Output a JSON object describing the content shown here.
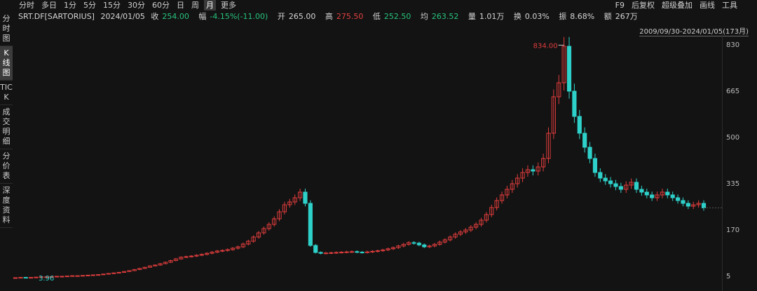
{
  "toolbar": {
    "periods": [
      "分时",
      "多日",
      "1分",
      "5分",
      "15分",
      "30分",
      "60分",
      "日",
      "周",
      "月",
      "更多"
    ],
    "active": "月",
    "right": [
      "F9",
      "后复权",
      "超级叠加",
      "画线",
      "工具"
    ]
  },
  "left_tabs": [
    {
      "label": "分时图",
      "active": false
    },
    {
      "label": "K线图",
      "active": true
    },
    {
      "label": "TICK",
      "active": false
    },
    {
      "label": "成交明细",
      "active": false
    },
    {
      "label": "分价表",
      "active": false
    },
    {
      "label": "深度资料",
      "active": false
    }
  ],
  "info": {
    "ticker": "SRT.DF[SARTORIUS]",
    "date": "2024/01/05",
    "close_label": "收",
    "close": "254.00",
    "chg_label": "幅",
    "chg": "-4.15%(-11.00)",
    "open_label": "开",
    "open": "265.00",
    "high_label": "高",
    "high": "275.50",
    "low_label": "低",
    "low": "252.50",
    "avg_label": "均",
    "avg": "263.52",
    "vol_label": "量",
    "vol": "1.01万",
    "turn_label": "换",
    "turn": "0.03%",
    "amp_label": "振",
    "amp": "8.68%",
    "amt_label": "额",
    "amt": "267万"
  },
  "range_label": "2009/09/30-2024/01/05(173月)",
  "colors": {
    "up": "#e03c3c",
    "down": "#2ed1c9",
    "bg": "#131313"
  },
  "chart_data": {
    "type": "candlestick",
    "frequency": "monthly",
    "x_range": [
      "2009/09",
      "2024/01"
    ],
    "y_ticks": [
      830,
      665,
      500,
      335,
      170,
      5
    ],
    "ylim": [
      5,
      830
    ],
    "max_label": "834.00",
    "min_label": "3.96",
    "series_close": [
      5,
      6,
      5,
      6,
      7,
      8,
      8,
      9,
      10,
      10,
      11,
      12,
      12,
      13,
      14,
      15,
      16,
      18,
      20,
      22,
      24,
      27,
      30,
      34,
      38,
      42,
      47,
      50,
      55,
      60,
      66,
      72,
      78,
      80,
      82,
      85,
      88,
      92,
      96,
      100,
      102,
      105,
      110,
      115,
      125,
      135,
      150,
      165,
      180,
      195,
      215,
      240,
      265,
      275,
      290,
      310,
      270,
      120,
      95,
      92,
      93,
      94,
      95,
      96,
      97,
      98,
      96,
      95,
      97,
      99,
      101,
      104,
      108,
      112,
      118,
      124,
      130,
      128,
      122,
      115,
      118,
      124,
      132,
      140,
      150,
      160,
      168,
      175,
      185,
      195,
      210,
      230,
      255,
      280,
      300,
      320,
      340,
      360,
      380,
      390,
      385,
      400,
      430,
      520,
      650,
      700,
      830,
      670,
      580,
      520,
      470,
      430,
      380,
      360,
      350,
      340,
      330,
      320,
      335,
      345,
      320,
      310,
      300,
      290,
      300,
      310,
      300,
      290,
      280,
      270,
      260,
      265,
      270,
      254
    ],
    "last_close": 254
  }
}
